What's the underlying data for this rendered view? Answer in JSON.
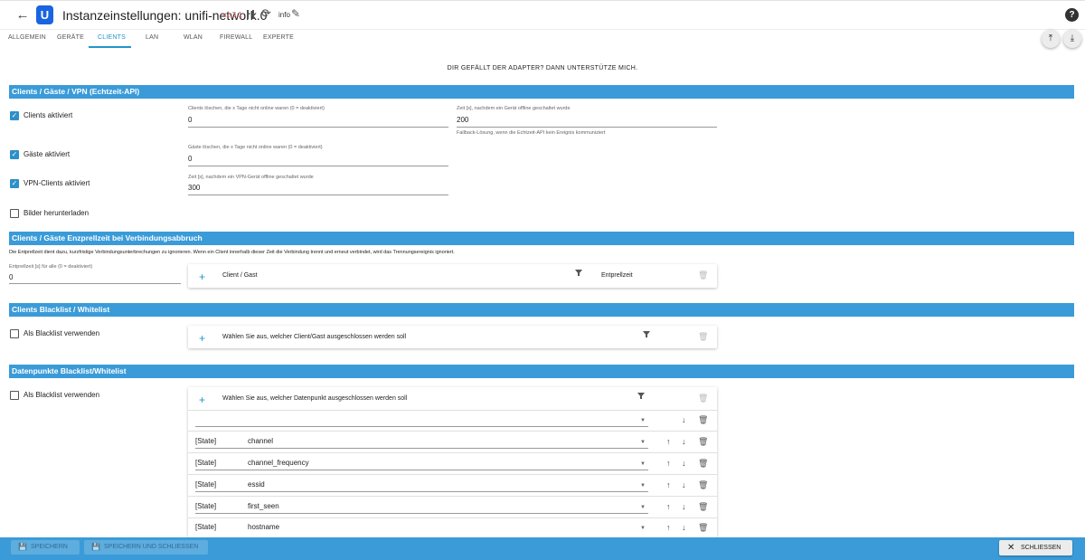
{
  "header": {
    "back_icon": "←",
    "logo_letter": "U",
    "title": "Instanzeinstellungen: unifi-network.0",
    "version": "v1.3.1",
    "info_label": "info",
    "help_icon": "?",
    "reload_icon": "⟳",
    "pencil_icon": "✎"
  },
  "tabs": [
    {
      "label": "Allgemein"
    },
    {
      "label": "Geräte"
    },
    {
      "label": "Clients"
    },
    {
      "label": "LAN"
    },
    {
      "label": "WLAN"
    },
    {
      "label": "Firewall"
    },
    {
      "label": "Experte"
    }
  ],
  "active_tab": "Clients",
  "promo": "DIR GEFÄLLT DER ADAPTER? DANN UNTERSTÜTZE MICH.",
  "sections": {
    "realtime": {
      "title": "Clients / Gäste / VPN (Echtzeit-API)",
      "clients_enabled": {
        "label": "Clients aktiviert",
        "checked": true
      },
      "guests_enabled": {
        "label": "Gäste aktiviert",
        "checked": true
      },
      "vpn_enabled": {
        "label": "VPN-Clients aktiviert",
        "checked": true
      },
      "download_images": {
        "label": "Bilder herunterladen",
        "checked": false
      },
      "clients_delete": {
        "label": "Clients löschen, die x Tage nicht online waren (0 = deaktiviert)",
        "value": "0"
      },
      "guests_delete": {
        "label": "Gäste löschen, die x Tage nicht online waren (0 = deaktiviert)",
        "value": "0"
      },
      "vpn_offline": {
        "label": "Zeit [s], nachdem ein VPN-Gerät offline geschaltet wurde",
        "value": "300"
      },
      "device_offline": {
        "label": "Zeit [s], nachdem ein Gerät offline geschaltet wurde",
        "value": "200",
        "help": "Fallback-Lösung, wenn die Echtzeit-API kein Ereignis kommuniziert"
      }
    },
    "debounce": {
      "title": "Clients / Gäste Enzprellzeit bei Verbindungsabbruch",
      "description": "Die Entprellzeit dient dazu, kurzfristige Verbindungsunterbrechungen zu ignorieren. Wenn ein Client innerhalb dieser Zeit die Verbindung trennt und erneut verbindet, wird das Trennungsereignis ignoriert.",
      "all_label": "Entprellzeit [s] für alle (0 = deaktiviert)",
      "all_value": "0",
      "col_client": "Client / Gast",
      "col_time": "Entprellzeit"
    },
    "clients_list": {
      "title": "Clients Blacklist / Whitelist",
      "checkbox": {
        "label": "Als Blacklist verwenden",
        "checked": false
      },
      "hint": "Wählen Sie aus, welcher Client/Gast ausgeschlossen werden soll"
    },
    "datapoints": {
      "title": "Datenpunkte Blacklist/Whitelist",
      "checkbox": {
        "label": "Als Blacklist verwenden",
        "checked": false
      },
      "hint": "Wählen Sie aus, welcher Datenpunkt ausgeschlossen werden soll",
      "rows": [
        {
          "type": "",
          "name": ""
        },
        {
          "type": "[State]",
          "name": "channel"
        },
        {
          "type": "[State]",
          "name": "channel_frequency"
        },
        {
          "type": "[State]",
          "name": "essid"
        },
        {
          "type": "[State]",
          "name": "first_seen"
        },
        {
          "type": "[State]",
          "name": "hostname"
        }
      ]
    }
  },
  "footer": {
    "save": "Speichern",
    "save_close": "Speichern und schliessen",
    "close": "Schliessen"
  },
  "colors": {
    "accent": "#3a9bd8",
    "active_tab": "#2196c9",
    "version": "#d9534f"
  }
}
